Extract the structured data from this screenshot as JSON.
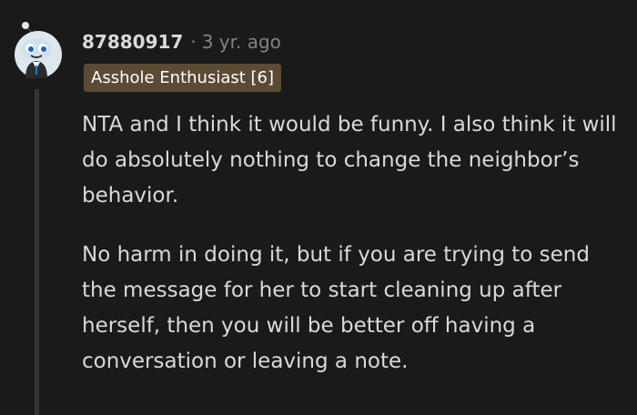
{
  "comment": {
    "username": "87880917",
    "separator": "·",
    "timestamp": "3 yr. ago",
    "flair": "Asshole Enthusiast [6]",
    "paragraphs": [
      "NTA and I think it would be funny. I also think it will do absolutely nothing to change the neighbor’s behavior.",
      "No harm in doing it, but if you are trying to send the message for her to start cleaning up after herself, then you will be better off having a conversation or leaving a note."
    ]
  },
  "colors": {
    "background": "#1a1a1b",
    "text": "#d7dadc",
    "muted": "#818384",
    "flair_bg": "#5b4a34",
    "thread_line": "#343536",
    "avatar_bg": "#e0e7ec"
  },
  "icons": {
    "avatar": "snoo-avatar-icon"
  }
}
